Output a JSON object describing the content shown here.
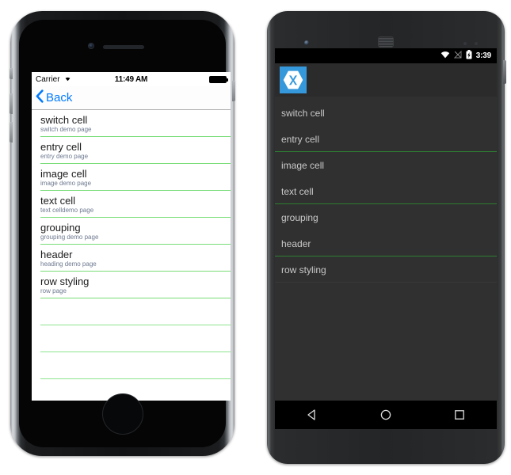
{
  "iphone": {
    "status_bar": {
      "carrier": "Carrier",
      "wifi_icon": "wifi-icon",
      "time": "11:49 AM",
      "battery_icon": "battery-full-icon"
    },
    "nav": {
      "back_label": "Back",
      "back_chevron_icon": "chevron-left-icon"
    },
    "list": {
      "rows": [
        {
          "title": "switch cell",
          "detail": "switch demo page"
        },
        {
          "title": "entry cell",
          "detail": "entry demo page"
        },
        {
          "title": "image cell",
          "detail": "image demo page"
        },
        {
          "title": "text cell",
          "detail": "text celldemo page"
        },
        {
          "title": "grouping",
          "detail": "grouping demo page"
        },
        {
          "title": "header",
          "detail": "heading demo page"
        },
        {
          "title": "row styling",
          "detail": "row page"
        }
      ],
      "empty_row_count": 4,
      "separator_color": "#77dd77"
    },
    "hardware": {
      "camera": "front-camera",
      "speaker": "earpiece-speaker",
      "home_button": "home-button",
      "silent_switch": "silent-switch",
      "volume_up": "volume-up-button",
      "volume_down": "volume-down-button",
      "power": "power-button"
    }
  },
  "android": {
    "status_bar": {
      "wifi_icon": "wifi-icon",
      "signal_icon": "signal-none-icon",
      "battery_icon": "battery-charging-icon",
      "clock": "3:39"
    },
    "action_bar": {
      "app_icon": "xamarin-logo-icon",
      "icon_bg_color": "#3498db"
    },
    "list": {
      "rows": [
        {
          "title": "switch cell",
          "separator": "none"
        },
        {
          "title": "entry cell",
          "separator": "green"
        },
        {
          "title": "image cell",
          "separator": "none"
        },
        {
          "title": "text cell",
          "separator": "green"
        },
        {
          "title": "grouping",
          "separator": "none"
        },
        {
          "title": "header",
          "separator": "green"
        },
        {
          "title": "row styling",
          "separator": "light"
        }
      ],
      "separator_color": "#2e7d32"
    },
    "nav_bar": {
      "back_icon": "back-triangle-icon",
      "home_icon": "home-circle-icon",
      "recents_icon": "recents-square-icon"
    },
    "hardware": {
      "camera": "front-camera",
      "speaker": "earpiece-speaker",
      "power": "power-button"
    }
  }
}
